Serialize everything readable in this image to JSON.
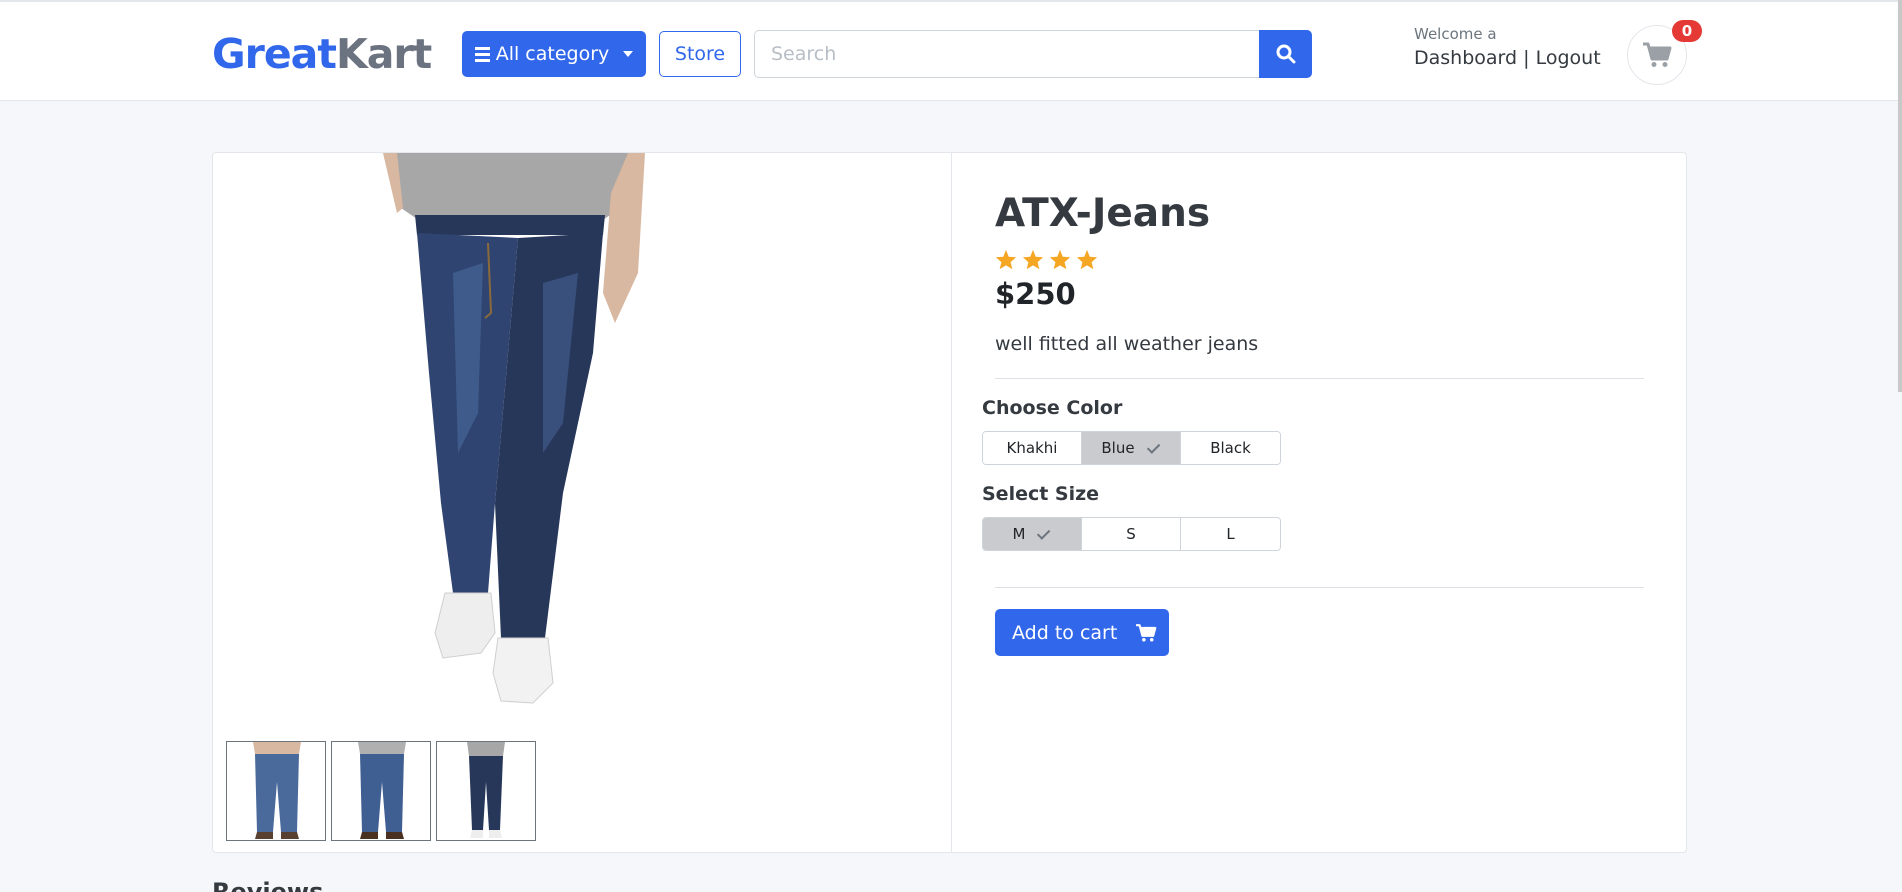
{
  "header": {
    "logo_part1": "Great",
    "logo_part2": "Kart",
    "category_button": "All category",
    "store_button": "Store",
    "search_placeholder": "Search",
    "welcome_text": "Welcome a",
    "dashboard_link": "Dashboard",
    "separator": "|",
    "logout_link": "Logout",
    "cart_count": "0"
  },
  "product": {
    "title": "ATX-Jeans",
    "rating_stars": 4,
    "price": "$250",
    "description": "well fitted all weather jeans",
    "color_label": "Choose Color",
    "colors": [
      "Khakhi",
      "Blue",
      "Black"
    ],
    "selected_color": "Blue",
    "size_label": "Select Size",
    "sizes": [
      "M",
      "S",
      "L"
    ],
    "selected_size": "M",
    "add_to_cart": "Add to cart"
  },
  "reviews_heading": "Reviews",
  "colors": {
    "primary": "#3167eb",
    "star": "#f5a623",
    "badge": "#e53935",
    "denim_dark": "#27375a",
    "denim_light": "#4a6a9c"
  }
}
